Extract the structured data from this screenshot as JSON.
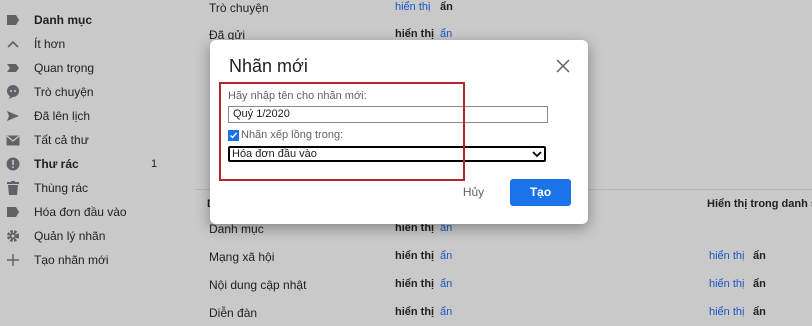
{
  "sidebar": {
    "items": [
      {
        "label": "Danh mục",
        "icon": "label-icon",
        "bold": true
      },
      {
        "label": "Ít hơn",
        "icon": "chevron-up-icon"
      },
      {
        "label": "Quan trọng",
        "icon": "important-icon"
      },
      {
        "label": "Trò chuyện",
        "icon": "chat-icon"
      },
      {
        "label": "Đã lên lịch",
        "icon": "scheduled-icon"
      },
      {
        "label": "Tất cả thư",
        "icon": "all-mail-icon"
      },
      {
        "label": "Thư rác",
        "icon": "spam-icon",
        "bold": true,
        "count": "1"
      },
      {
        "label": "Thùng rác",
        "icon": "trash-icon"
      },
      {
        "label": "Hóa đơn đầu vào",
        "icon": "label-icon"
      },
      {
        "label": "Quản lý nhãn",
        "icon": "gear-icon"
      },
      {
        "label": "Tạo nhãn mới",
        "icon": "plus-icon"
      }
    ]
  },
  "main": {
    "top_rows": [
      {
        "name": "Trò chuyện",
        "show": "hiển thị",
        "hide": "ẩn"
      },
      {
        "name": "Đã gửi",
        "show": "hiển thị",
        "hide": "ẩn"
      }
    ],
    "column_header_left": "D",
    "column_header_right": "Hiển thị trong danh sá",
    "bottom_rows": [
      {
        "name": "Danh mục",
        "show": "hiển thị",
        "hide": "ẩn"
      },
      {
        "name": "Mạng xã hội",
        "show": "hiển thị",
        "hide": "ẩn",
        "show2": "hiển thị",
        "hide2": "ẩn"
      },
      {
        "name": "Nội dung cập nhật",
        "show": "hiển thị",
        "hide": "ẩn",
        "show2": "hiển thị",
        "hide2": "ẩn"
      },
      {
        "name": "Diễn đàn",
        "show": "hiển thị",
        "hide": "ẩn",
        "show2": "hiển thị",
        "hide2": "ẩn"
      }
    ]
  },
  "dialog": {
    "title": "Nhãn mới",
    "name_label": "Hãy nhập tên cho nhãn mới:",
    "name_value": "Quý 1/2020",
    "nest_label": "Nhãn xếp lồng trong:",
    "nest_checked": true,
    "parent_selected": "Hóa đơn đầu vào",
    "cancel_label": "Hủy",
    "create_label": "Tạo"
  },
  "colors": {
    "accent": "#1a73e8",
    "highlight": "#b3262e",
    "link": "#1a57c6"
  }
}
